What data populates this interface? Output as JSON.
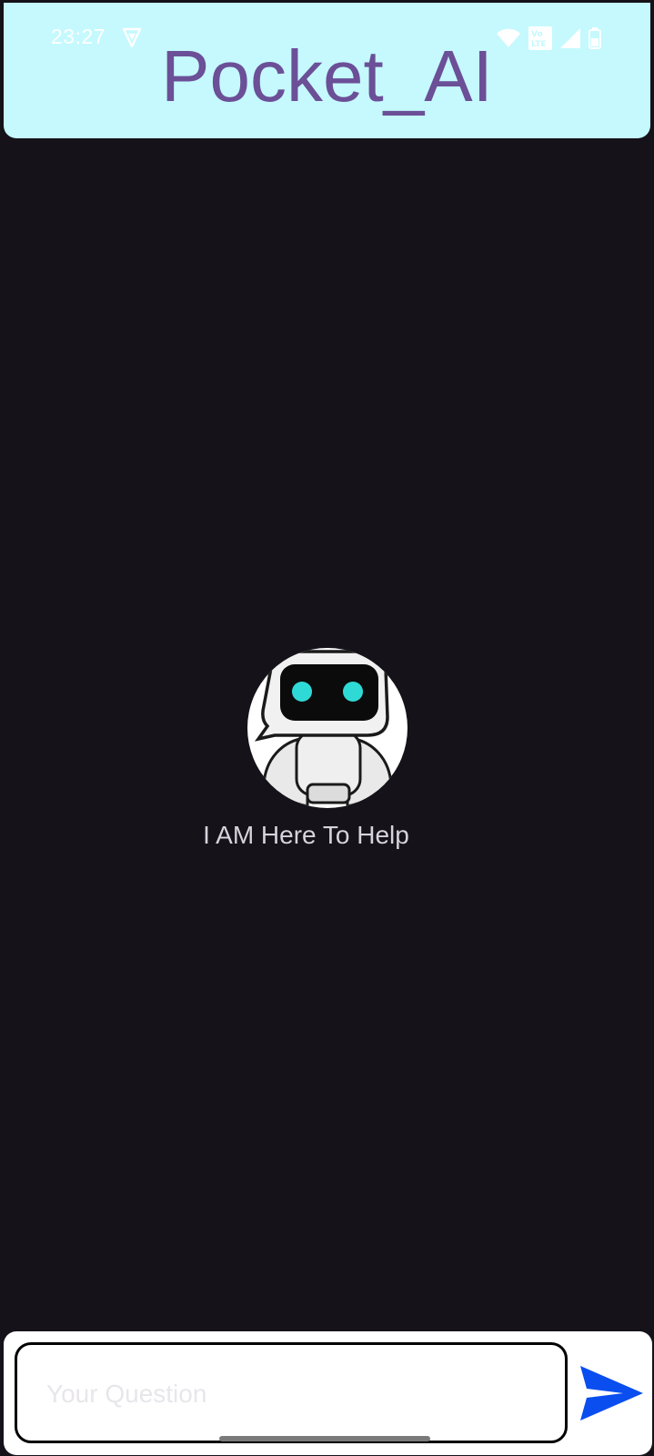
{
  "status_bar": {
    "time": "23:27"
  },
  "app": {
    "title": "Pocket_AI"
  },
  "main": {
    "welcome_text": "I AM Here To Help",
    "avatar_icon": "robot-avatar-icon"
  },
  "composer": {
    "placeholder": "Your Question",
    "value": "",
    "send_icon": "send-icon"
  },
  "colors": {
    "header_bg": "#c5f9fd",
    "title_color": "#6b4f97",
    "background": "#15121a",
    "send_blue": "#0a4ef0"
  }
}
